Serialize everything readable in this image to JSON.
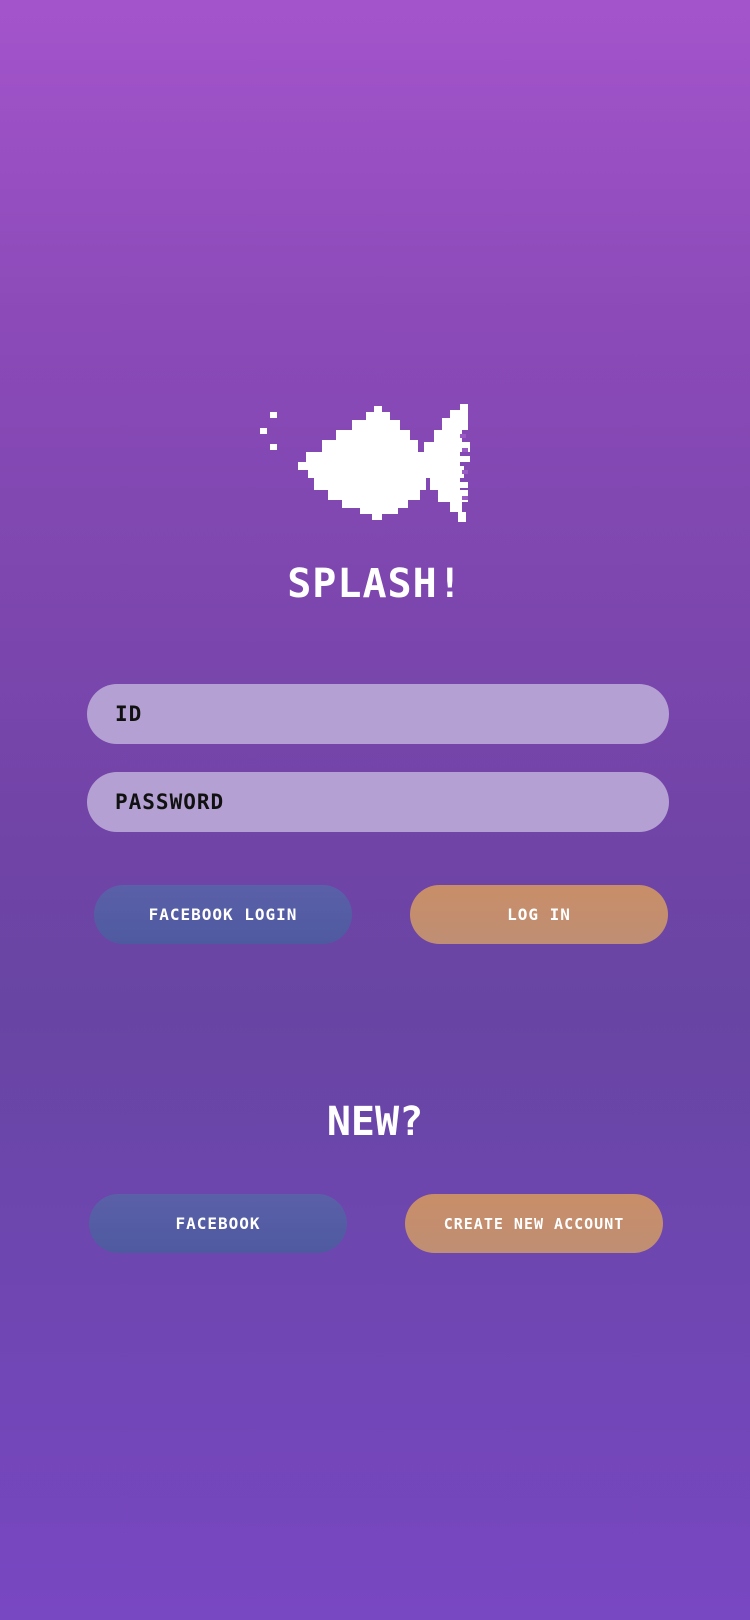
{
  "app": {
    "name": "SPLASH!"
  },
  "colors": {
    "background_top": "#a454cb",
    "background_bottom": "#7847c2",
    "field": "#b5a0d3",
    "facebook_button": "#5b60a8",
    "primary_button": "#c98e68",
    "text_light": "#ffffff",
    "text_dark": "#111111"
  },
  "logo": {
    "icon": "pixel-fish-icon"
  },
  "login_form": {
    "id_placeholder": "ID",
    "password_placeholder": "PASSWORD",
    "facebook_login_label": "FACEBOOK LOGIN",
    "login_label": "LOG IN"
  },
  "signup": {
    "heading": "NEW?",
    "facebook_label": "FACEBOOK",
    "create_account_label": "CREATE NEW ACCOUNT"
  }
}
